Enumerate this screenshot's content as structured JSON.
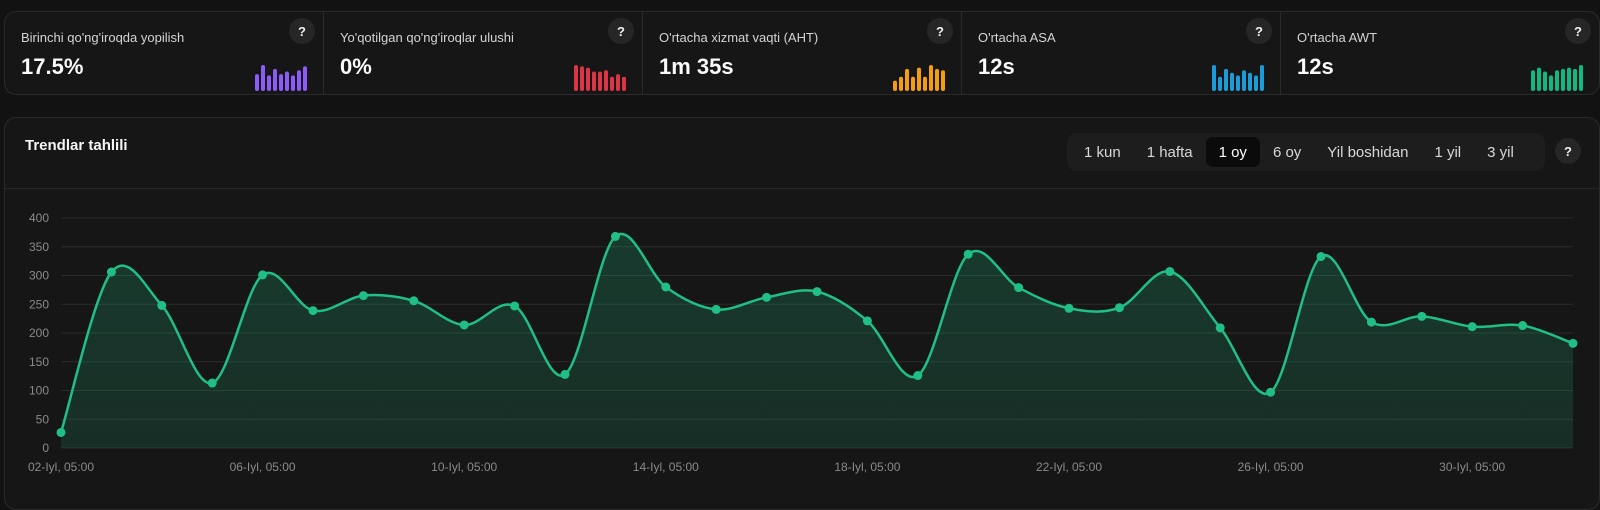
{
  "metrics": [
    {
      "label": "Birinchi qo'ng'iroqda yopilish",
      "value": "17.5%",
      "color": "#8b5cf6",
      "help": "?",
      "spark": [
        0.65,
        1.0,
        0.6,
        0.85,
        0.65,
        0.75,
        0.6,
        0.8,
        0.95
      ]
    },
    {
      "label": "Yo'qotilgan qo'ng'iroqlar ulushi",
      "value": "0%",
      "color": "#dc3545",
      "help": "?",
      "spark": [
        1.0,
        0.95,
        0.9,
        0.75,
        0.75,
        0.8,
        0.55,
        0.65,
        0.55
      ]
    },
    {
      "label": "O'rtacha xizmat vaqti (AHT)",
      "value": "1m 35s",
      "color": "#f59e0b",
      "help": "?",
      "spark": [
        0.4,
        0.55,
        0.85,
        0.55,
        0.9,
        0.55,
        1.0,
        0.85,
        0.8
      ]
    },
    {
      "label": "O'rtacha ASA",
      "value": "12s",
      "color": "#1d9bd8",
      "help": "?",
      "spark": [
        1.0,
        0.55,
        0.85,
        0.7,
        0.6,
        0.8,
        0.7,
        0.6,
        1.0
      ]
    },
    {
      "label": "O'rtacha AWT",
      "value": "12s",
      "color": "#10b981",
      "help": "?",
      "spark": [
        0.8,
        0.9,
        0.75,
        0.6,
        0.8,
        0.85,
        0.9,
        0.85,
        1.0
      ]
    }
  ],
  "trend": {
    "title": "Trendlar tahlili",
    "help": "?",
    "ranges": [
      {
        "label": "1 kun",
        "active": false
      },
      {
        "label": "1 hafta",
        "active": false
      },
      {
        "label": "1 oy",
        "active": true
      },
      {
        "label": "6 oy",
        "active": false
      },
      {
        "label": "Yil boshidan",
        "active": false
      },
      {
        "label": "1 yil",
        "active": false
      },
      {
        "label": "3 yil",
        "active": false
      }
    ]
  },
  "chart_data": {
    "type": "area",
    "categories": [
      "02-Iyl, 05:00",
      "03-Iyl, 05:00",
      "04-Iyl, 05:00",
      "05-Iyl, 05:00",
      "06-Iyl, 05:00",
      "07-Iyl, 05:00",
      "08-Iyl, 05:00",
      "09-Iyl, 05:00",
      "10-Iyl, 05:00",
      "11-Iyl, 05:00",
      "12-Iyl, 05:00",
      "13-Iyl, 05:00",
      "14-Iyl, 05:00",
      "15-Iyl, 05:00",
      "16-Iyl, 05:00",
      "17-Iyl, 05:00",
      "18-Iyl, 05:00",
      "19-Iyl, 05:00",
      "20-Iyl, 05:00",
      "21-Iyl, 05:00",
      "22-Iyl, 05:00",
      "23-Iyl, 05:00",
      "24-Iyl, 05:00",
      "25-Iyl, 05:00",
      "26-Iyl, 05:00",
      "27-Iyl, 05:00",
      "28-Iyl, 05:00",
      "29-Iyl, 05:00",
      "30-Iyl, 05:00",
      "31-Iyl, 05:00",
      "01-Avg, 05:00"
    ],
    "tick_labels": [
      "02-Iyl, 05:00",
      "06-Iyl, 05:00",
      "10-Iyl, 05:00",
      "14-Iyl, 05:00",
      "18-Iyl, 05:00",
      "22-Iyl, 05:00",
      "26-Iyl, 05:00",
      "30-Iyl, 05:00"
    ],
    "series": [
      {
        "values": [
          27,
          306,
          248,
          113,
          301,
          239,
          265,
          256,
          214,
          247,
          128,
          368,
          280,
          241,
          262,
          272,
          221,
          126,
          337,
          279,
          243,
          244,
          307,
          209,
          97,
          333,
          219,
          229,
          211,
          213,
          182
        ]
      }
    ],
    "ylim": [
      0,
      400
    ],
    "yticks": [
      0,
      50,
      100,
      150,
      200,
      250,
      300,
      350,
      400
    ],
    "grid": true,
    "color": "#1fbf85",
    "title": "",
    "xlabel": "",
    "ylabel": ""
  }
}
